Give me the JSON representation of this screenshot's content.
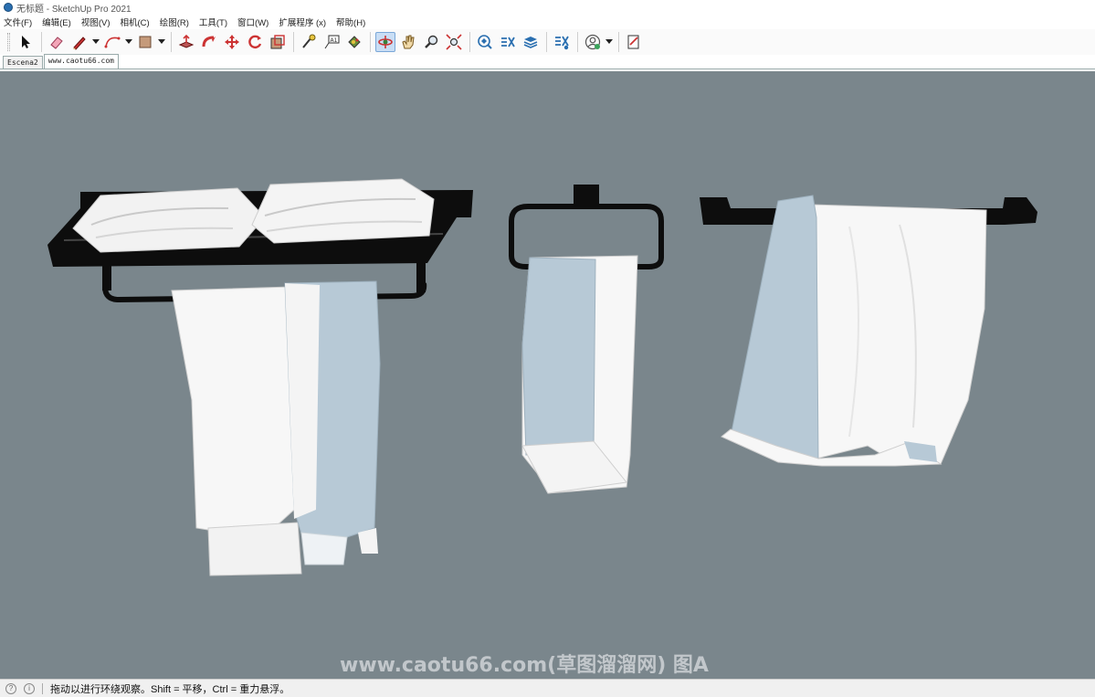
{
  "window": {
    "title": "无标题 - SketchUp Pro 2021",
    "icon": "sketchup-logo-icon"
  },
  "menu": [
    "文件(F)",
    "编辑(E)",
    "视图(V)",
    "相机(C)",
    "绘图(R)",
    "工具(T)",
    "窗口(W)",
    "扩展程序 (x)",
    "帮助(H)"
  ],
  "toolbar": {
    "tools": [
      {
        "icon": "select-arrow-icon"
      },
      {
        "icon": "eraser-icon"
      },
      {
        "icon": "pencil-line-icon",
        "dropdown": true
      },
      {
        "icon": "arc-icon",
        "dropdown": true
      },
      {
        "icon": "rectangle-shape-icon",
        "dropdown": true
      },
      {
        "icon": "push-pull-icon"
      },
      {
        "icon": "follow-me-icon"
      },
      {
        "icon": "move-icon"
      },
      {
        "icon": "rotate-icon"
      },
      {
        "icon": "scale-icon"
      },
      {
        "icon": "tape-measure-icon"
      },
      {
        "icon": "text-label-icon"
      },
      {
        "icon": "paint-bucket-icon"
      },
      {
        "icon": "orbit-icon",
        "active": true
      },
      {
        "icon": "pan-hand-icon"
      },
      {
        "icon": "zoom-icon"
      },
      {
        "icon": "zoom-extents-icon"
      },
      {
        "icon": "3d-warehouse-icon"
      },
      {
        "icon": "extension-warehouse-icon"
      },
      {
        "icon": "layout-icon"
      },
      {
        "icon": "extension-manager-icon"
      },
      {
        "icon": "account-icon",
        "dropdown": true
      },
      {
        "icon": "sketchup-notes-icon"
      }
    ]
  },
  "scenes": [
    "Escena2",
    "www.caotu66.com"
  ],
  "selected_scene": "www.caotu66.com",
  "viewport": {
    "background": "#7a868c",
    "watermark": "www.caotu66.com(草图溜溜网) 图A"
  },
  "statusbar": {
    "text": "拖动以进行环绕观察。Shift = 平移，Ctrl = 重力悬浮。"
  },
  "colors": {
    "towel_white": "#f7f7f7",
    "towel_blue": "#b7c9d6",
    "rack": "#0d0d0d",
    "active_tool": "#c9def5"
  }
}
